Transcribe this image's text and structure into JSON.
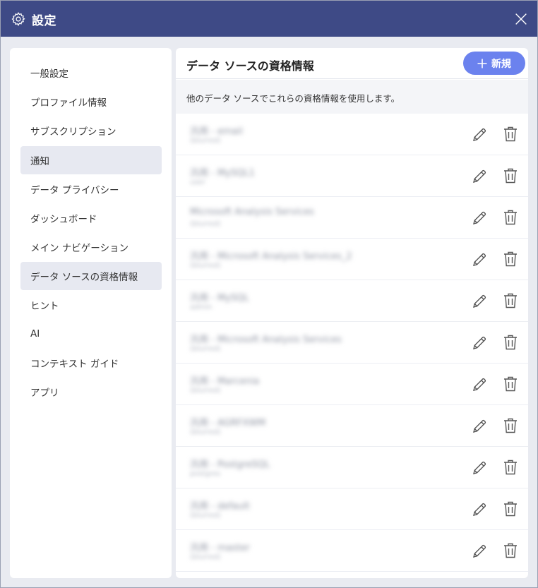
{
  "window": {
    "title": "設定",
    "accent": "#3e4a86"
  },
  "sidebar": {
    "items": [
      {
        "label": "一般設定",
        "selected": false
      },
      {
        "label": "プロファイル情報",
        "selected": false
      },
      {
        "label": "サブスクリプション",
        "selected": false
      },
      {
        "label": "通知",
        "selected": true
      },
      {
        "label": "データ プライバシー",
        "selected": false
      },
      {
        "label": "ダッシュボード",
        "selected": false
      },
      {
        "label": "メイン ナビゲーション",
        "selected": false
      },
      {
        "label": "データ ソースの資格情報",
        "selected": true
      },
      {
        "label": "ヒント",
        "selected": false
      },
      {
        "label": "AI",
        "selected": false
      },
      {
        "label": "コンテキスト ガイド",
        "selected": false
      },
      {
        "label": "アプリ",
        "selected": false
      }
    ]
  },
  "main": {
    "title": "データ ソースの資格情報",
    "new_button": "新規",
    "new_button_color": "#6b82ee",
    "description": "他のデータ ソースでこれらの資格情報を使用します。",
    "credentials": [
      {
        "name": "汎用 - email",
        "sub": "(blurred)"
      },
      {
        "name": "汎用 - MySQL1",
        "sub": "user"
      },
      {
        "name": "Microsoft Analysis Services",
        "sub": "(blurred)"
      },
      {
        "name": "汎用 - Microsoft Analysis Services_2",
        "sub": "(blurred)"
      },
      {
        "name": "汎用 - MySQL",
        "sub": "admin"
      },
      {
        "name": "汎用 - Microsoft Analysis Services",
        "sub": "(blurred)"
      },
      {
        "name": "汎用 - Marcenia",
        "sub": "(blurred)"
      },
      {
        "name": "汎用 - AGRFXWM",
        "sub": "(blurred)"
      },
      {
        "name": "汎用 - PostgreSQL",
        "sub": "postgres"
      },
      {
        "name": "汎用 - default",
        "sub": "(blurred)"
      },
      {
        "name": "汎用 - master",
        "sub": "(blurred)"
      }
    ]
  }
}
